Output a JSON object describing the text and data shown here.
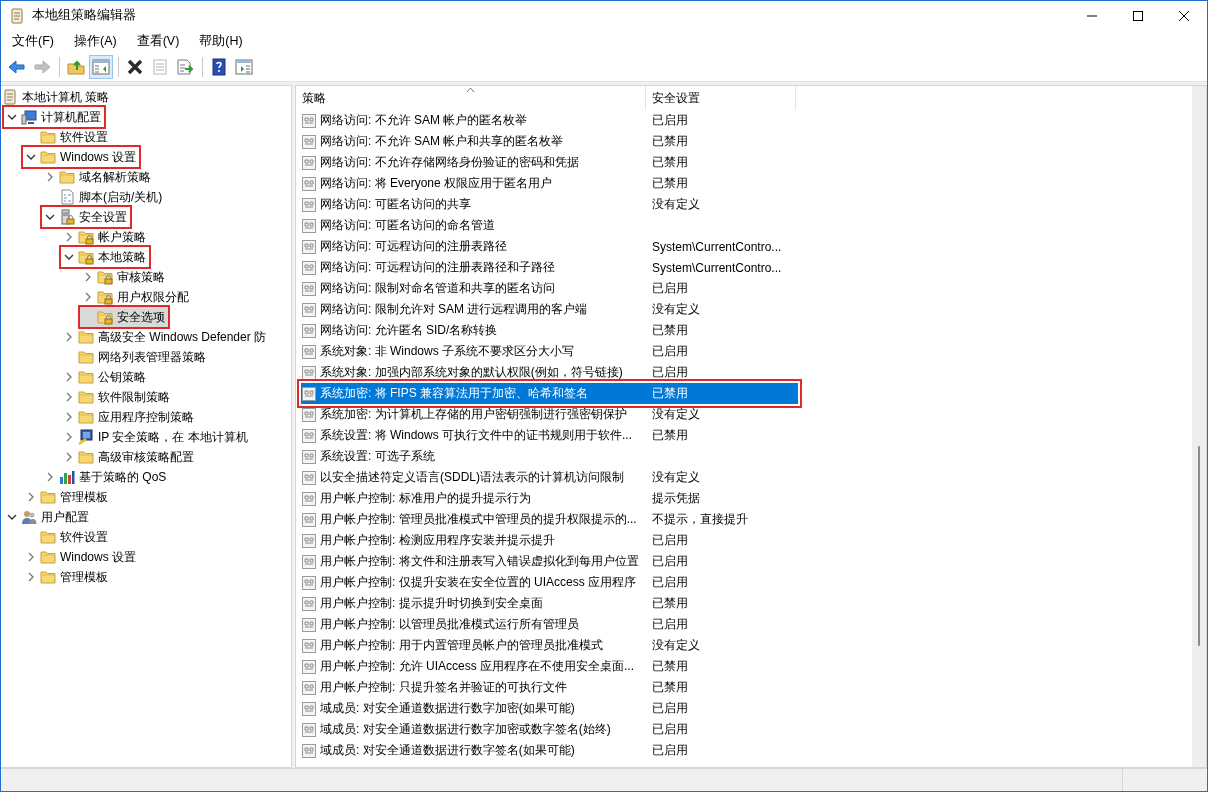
{
  "window": {
    "title": "本地组策略编辑器"
  },
  "menu": [
    "文件(F)",
    "操作(A)",
    "查看(V)",
    "帮助(H)"
  ],
  "toolbar": [
    {
      "kind": "back",
      "disabled": false,
      "pressed": false
    },
    {
      "kind": "forward",
      "disabled": true,
      "pressed": false
    },
    {
      "kind": "separator"
    },
    {
      "kind": "up",
      "disabled": false,
      "pressed": false
    },
    {
      "kind": "tree",
      "disabled": false,
      "pressed": true
    },
    {
      "kind": "separator"
    },
    {
      "kind": "delete",
      "disabled": false,
      "pressed": false
    },
    {
      "kind": "properties",
      "disabled": true,
      "pressed": false
    },
    {
      "kind": "export",
      "disabled": false,
      "pressed": false
    },
    {
      "kind": "separator"
    },
    {
      "kind": "help",
      "disabled": false,
      "pressed": false
    },
    {
      "kind": "actions",
      "disabled": false,
      "pressed": false
    }
  ],
  "tree": {
    "items": [
      {
        "label": "本地计算机 策略",
        "kind": "scroll",
        "selected": false,
        "marked": false,
        "children": [
          {
            "label": "计算机配置",
            "kind": "computer",
            "expanded": true,
            "selected": false,
            "marked": true,
            "children": [
              {
                "label": "软件设置",
                "kind": "folder",
                "selected": false,
                "marked": false
              },
              {
                "label": "Windows 设置",
                "kind": "folder",
                "expanded": true,
                "selected": false,
                "marked": true,
                "children": [
                  {
                    "label": "域名解析策略",
                    "kind": "folder",
                    "expanded": false,
                    "selected": false,
                    "marked": false
                  },
                  {
                    "label": "脚本(启动/关机)",
                    "kind": "script",
                    "selected": false,
                    "marked": false
                  },
                  {
                    "label": "安全设置",
                    "kind": "security",
                    "expanded": true,
                    "selected": false,
                    "marked": true,
                    "children": [
                      {
                        "label": "帐户策略",
                        "kind": "folder-lock",
                        "expanded": false,
                        "selected": false,
                        "marked": false
                      },
                      {
                        "label": "本地策略",
                        "kind": "folder-lock",
                        "expanded": true,
                        "selected": false,
                        "marked": true,
                        "children": [
                          {
                            "label": "审核策略",
                            "kind": "folder-lock",
                            "expanded": false,
                            "selected": false,
                            "marked": false
                          },
                          {
                            "label": "用户权限分配",
                            "kind": "folder-lock",
                            "expanded": false,
                            "selected": false,
                            "marked": false
                          },
                          {
                            "label": "安全选项",
                            "kind": "folder-lock",
                            "selected": true,
                            "marked": true
                          }
                        ]
                      },
                      {
                        "label": "高级安全 Windows Defender 防",
                        "kind": "folder",
                        "expanded": false,
                        "selected": false,
                        "marked": false
                      },
                      {
                        "label": "网络列表管理器策略",
                        "kind": "folder",
                        "selected": false,
                        "marked": false
                      },
                      {
                        "label": "公钥策略",
                        "kind": "folder",
                        "expanded": false,
                        "selected": false,
                        "marked": false
                      },
                      {
                        "label": "软件限制策略",
                        "kind": "folder",
                        "expanded": false,
                        "selected": false,
                        "marked": false
                      },
                      {
                        "label": "应用程序控制策略",
                        "kind": "folder",
                        "expanded": false,
                        "selected": false,
                        "marked": false
                      },
                      {
                        "label": "IP 安全策略，在 本地计算机",
                        "kind": "ip",
                        "expanded": false,
                        "selected": false,
                        "marked": false
                      },
                      {
                        "label": "高级审核策略配置",
                        "kind": "folder",
                        "expanded": false,
                        "selected": false,
                        "marked": false
                      }
                    ]
                  },
                  {
                    "label": "基于策略的 QoS",
                    "kind": "qos",
                    "expanded": false,
                    "selected": false,
                    "marked": false
                  }
                ]
              },
              {
                "label": "管理模板",
                "kind": "folder",
                "expanded": false,
                "selected": false,
                "marked": false
              }
            ]
          },
          {
            "label": "用户配置",
            "kind": "user",
            "expanded": true,
            "selected": false,
            "marked": false,
            "children": [
              {
                "label": "软件设置",
                "kind": "folder",
                "selected": false,
                "marked": false
              },
              {
                "label": "Windows 设置",
                "kind": "folder",
                "expanded": false,
                "selected": false,
                "marked": false
              },
              {
                "label": "管理模板",
                "kind": "folder",
                "expanded": false,
                "selected": false,
                "marked": false
              }
            ]
          }
        ]
      }
    ]
  },
  "list": {
    "columns": [
      {
        "label": "策略",
        "sorted": true
      },
      {
        "label": "安全设置",
        "sorted": false
      }
    ],
    "rows": [
      {
        "policy": "网络访问: 不允许 SAM 帐户的匿名枚举",
        "setting": "已启用",
        "selected": false,
        "marked": false
      },
      {
        "policy": "网络访问: 不允许 SAM 帐户和共享的匿名枚举",
        "setting": "已禁用",
        "selected": false,
        "marked": false
      },
      {
        "policy": "网络访问: 不允许存储网络身份验证的密码和凭据",
        "setting": "已禁用",
        "selected": false,
        "marked": false
      },
      {
        "policy": "网络访问: 将 Everyone 权限应用于匿名用户",
        "setting": "已禁用",
        "selected": false,
        "marked": false
      },
      {
        "policy": "网络访问: 可匿名访问的共享",
        "setting": "没有定义",
        "selected": false,
        "marked": false
      },
      {
        "policy": "网络访问: 可匿名访问的命名管道",
        "selected": false,
        "marked": false
      },
      {
        "policy": "网络访问: 可远程访问的注册表路径",
        "setting": "System\\CurrentContro...",
        "selected": false,
        "marked": false
      },
      {
        "policy": "网络访问: 可远程访问的注册表路径和子路径",
        "setting": "System\\CurrentContro...",
        "selected": false,
        "marked": false
      },
      {
        "policy": "网络访问: 限制对命名管道和共享的匿名访问",
        "setting": "已启用",
        "selected": false,
        "marked": false
      },
      {
        "policy": "网络访问: 限制允许对 SAM 进行远程调用的客户端",
        "setting": "没有定义",
        "selected": false,
        "marked": false
      },
      {
        "policy": "网络访问: 允许匿名 SID/名称转换",
        "setting": "已禁用",
        "selected": false,
        "marked": false
      },
      {
        "policy": "系统对象: 非 Windows 子系统不要求区分大小写",
        "setting": "已启用",
        "selected": false,
        "marked": false
      },
      {
        "policy": "系统对象: 加强内部系统对象的默认权限(例如，符号链接)",
        "setting": "已启用",
        "selected": false,
        "marked": false
      },
      {
        "policy": "系统加密: 将 FIPS 兼容算法用于加密、哈希和签名",
        "setting": "已禁用",
        "selected": true,
        "marked": true
      },
      {
        "policy": "系统加密: 为计算机上存储的用户密钥强制进行强密钥保护",
        "setting": "没有定义",
        "selected": false,
        "marked": false
      },
      {
        "policy": "系统设置: 将 Windows 可执行文件中的证书规则用于软件...",
        "setting": "已禁用",
        "selected": false,
        "marked": false
      },
      {
        "policy": "系统设置: 可选子系统",
        "selected": false,
        "marked": false
      },
      {
        "policy": "以安全描述符定义语言(SDDL)语法表示的计算机访问限制",
        "setting": "没有定义",
        "selected": false,
        "marked": false
      },
      {
        "policy": "用户帐户控制: 标准用户的提升提示行为",
        "setting": "提示凭据",
        "selected": false,
        "marked": false
      },
      {
        "policy": "用户帐户控制: 管理员批准模式中管理员的提升权限提示的...",
        "setting": "不提示，直接提升",
        "selected": false,
        "marked": false
      },
      {
        "policy": "用户帐户控制: 检测应用程序安装并提示提升",
        "setting": "已启用",
        "selected": false,
        "marked": false
      },
      {
        "policy": "用户帐户控制: 将文件和注册表写入错误虚拟化到每用户位置",
        "setting": "已启用",
        "selected": false,
        "marked": false
      },
      {
        "policy": "用户帐户控制: 仅提升安装在安全位置的 UIAccess 应用程序",
        "setting": "已启用",
        "selected": false,
        "marked": false
      },
      {
        "policy": "用户帐户控制: 提示提升时切换到安全桌面",
        "setting": "已禁用",
        "selected": false,
        "marked": false
      },
      {
        "policy": "用户帐户控制: 以管理员批准模式运行所有管理员",
        "setting": "已启用",
        "selected": false,
        "marked": false
      },
      {
        "policy": "用户帐户控制: 用于内置管理员帐户的管理员批准模式",
        "setting": "没有定义",
        "selected": false,
        "marked": false
      },
      {
        "policy": "用户帐户控制: 允许 UIAccess 应用程序在不使用安全桌面...",
        "setting": "已禁用",
        "selected": false,
        "marked": false
      },
      {
        "policy": "用户帐户控制: 只提升签名并验证的可执行文件",
        "setting": "已禁用",
        "selected": false,
        "marked": false
      },
      {
        "policy": "域成员: 对安全通道数据进行数字加密(如果可能)",
        "setting": "已启用",
        "selected": false,
        "marked": false
      },
      {
        "policy": "域成员: 对安全通道数据进行数字加密或数字签名(始终)",
        "setting": "已启用",
        "selected": false,
        "marked": false
      },
      {
        "policy": "域成员: 对安全通道数据进行数字签名(如果可能)",
        "setting": "已启用",
        "selected": false,
        "marked": false
      }
    ]
  }
}
